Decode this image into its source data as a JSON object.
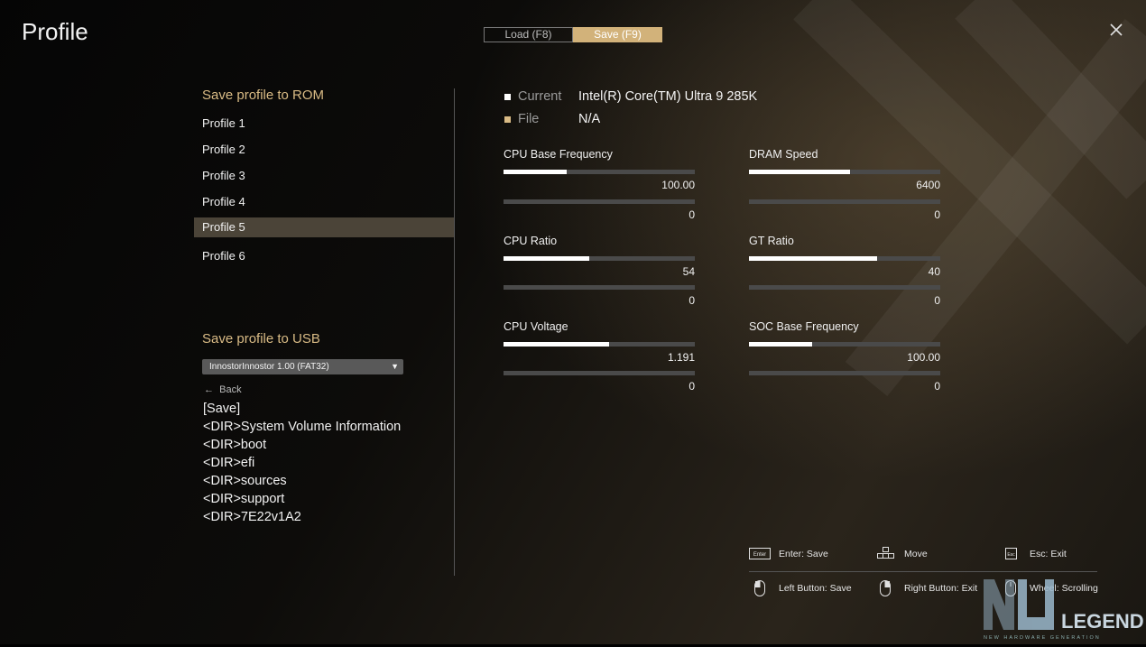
{
  "title": "Profile",
  "tabs": [
    {
      "label": "Load (F8)",
      "active": false
    },
    {
      "label": "Save (F9)",
      "active": true
    }
  ],
  "rom": {
    "heading": "Save profile to ROM",
    "profiles": [
      "Profile 1",
      "Profile 2",
      "Profile 3",
      "Profile 4",
      "Profile 5",
      "Profile 6"
    ],
    "selected": "Profile 5"
  },
  "usb": {
    "heading": "Save profile to USB",
    "drive": "InnostorInnostor  1.00 (FAT32)",
    "back": "Back",
    "entries": [
      "[Save]",
      "<DIR>System Volume Information",
      "<DIR>boot",
      "<DIR>efi",
      "<DIR>sources",
      "<DIR>support",
      "<DIR>7E22v1A2"
    ]
  },
  "info": {
    "current_label": "Current",
    "current_value": "Intel(R) Core(TM) Ultra 9 285K",
    "file_label": "File",
    "file_value": "N/A"
  },
  "params": [
    {
      "label": "CPU Base Frequency",
      "current": "100.00",
      "current_level": 0.33,
      "file": "0"
    },
    {
      "label": "DRAM Speed",
      "current": "6400",
      "current_level": 0.53,
      "file": "0"
    },
    {
      "label": "CPU Ratio",
      "current": "54",
      "current_level": 0.45,
      "file": "0"
    },
    {
      "label": "GT Ratio",
      "current": "40",
      "current_level": 0.67,
      "file": "0"
    },
    {
      "label": "CPU Voltage",
      "current": "1.191",
      "current_level": 0.55,
      "file": "0"
    },
    {
      "label": "SOC Base Frequency",
      "current": "100.00",
      "current_level": 0.33,
      "file": "0"
    }
  ],
  "hints": {
    "enter": "Enter: Save",
    "move": "Move",
    "esc": "Esc: Exit",
    "left_button": "Left Button: Save",
    "right_button": "Right Button: Exit",
    "wheel": "Wheel: Scrolling",
    "enter_key": "Enter",
    "esc_key": "Esc"
  },
  "colors": {
    "accent": "#d9bb85",
    "tab_active": "#d2b27a",
    "selected_row": "#4b4438",
    "bar_fill": "#ffffff",
    "bar_track": "#4a4a4a"
  },
  "icons": {
    "close": "close-icon",
    "back": "arrow-left-icon",
    "dropdown": "caret-down-icon",
    "move": "arrow-keys-icon",
    "mouse": "mouse-icon"
  }
}
